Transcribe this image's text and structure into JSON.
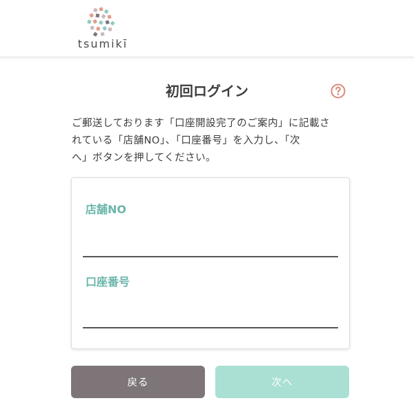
{
  "header": {
    "logo_text": "tsumikī",
    "logo_icon": "tsumiki-blocks-logo"
  },
  "page": {
    "title": "初回ログイン",
    "help_icon": "question-circle-icon",
    "intro_lines": [
      "ご郵送しております「口座開設完了のご案内」に記載さ",
      "れている「店舗NO」、「口座番号」を入力し、「次",
      "へ」ボタンを押してください。"
    ]
  },
  "form": {
    "store_no": {
      "label": "店舗NO",
      "value": ""
    },
    "account_no": {
      "label": "口座番号",
      "value": ""
    }
  },
  "buttons": {
    "back_label": "戻る",
    "next_label": "次へ"
  },
  "colors": {
    "accent_teal": "#6bb6aa",
    "next_button": "#aadfd4",
    "back_button": "#7d7578",
    "help_icon": "#d98a78"
  }
}
